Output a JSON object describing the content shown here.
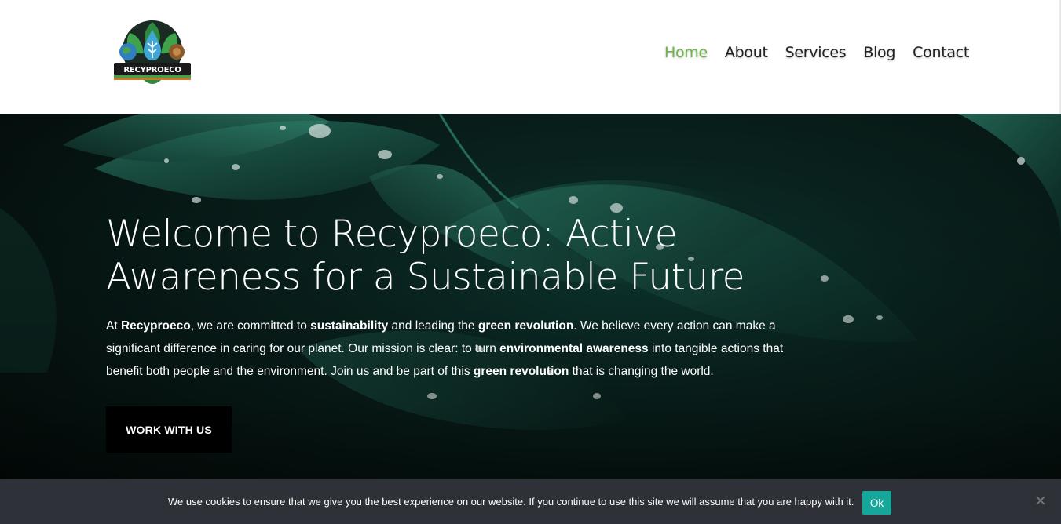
{
  "brand": {
    "logo_text": "RECYPROECO"
  },
  "nav": {
    "items": [
      {
        "label": "Home",
        "active": true
      },
      {
        "label": "About",
        "active": false
      },
      {
        "label": "Services",
        "active": false
      },
      {
        "label": "Blog",
        "active": false
      },
      {
        "label": "Contact",
        "active": false
      }
    ]
  },
  "hero": {
    "title_line1": "Welcome to Recyproeco: Active",
    "title_line2": "Awareness for a Sustainable Future",
    "paragraph": {
      "p1": "At ",
      "b1": "Recyproeco",
      "p2": ", we are committed to ",
      "b2": "sustainability",
      "p3": " and leading the ",
      "b3": "green revolution",
      "p4": ". We believe every action can make a significant difference in caring for our planet. Our mission is clear: to turn ",
      "b4": "environmental awareness",
      "p5": " into tangible actions that benefit both people and the environment. Join us and be part of this ",
      "b5": "green revolution",
      "p6": " that is changing the world."
    },
    "cta_label": "WORK WITH US"
  },
  "cookie": {
    "message": "We use cookies to ensure that we give you the best experience on our website. If you continue to use this site we will assume that you are happy with it.",
    "ok_label": "Ok",
    "close_glyph": "✕"
  },
  "colors": {
    "nav_active": "#6fb34a",
    "cookie_bg": "#2f3138",
    "cookie_ok": "#16a69a",
    "hero_dark": "#0a2420"
  }
}
